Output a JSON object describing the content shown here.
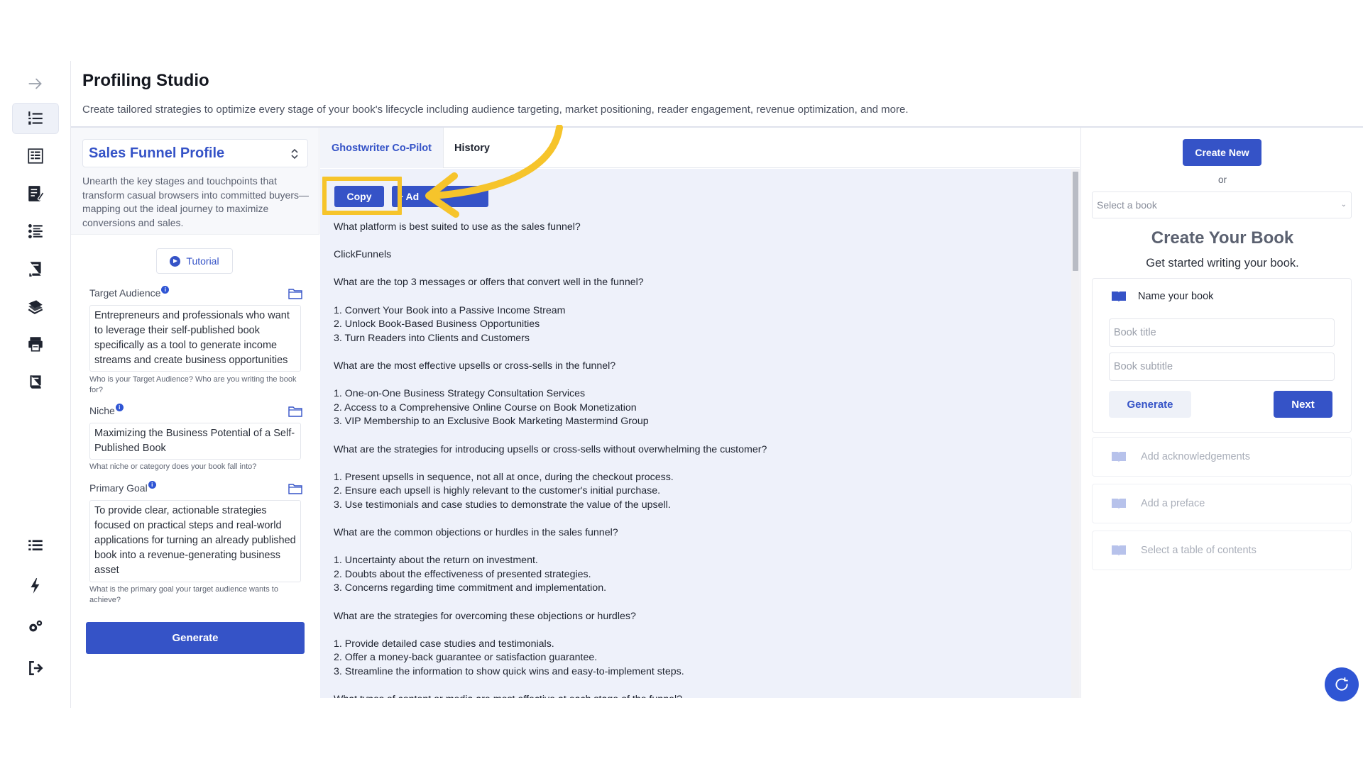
{
  "header": {
    "title": "Profiling Studio",
    "subtitle": "Create tailored strategies to optimize every stage of your book's lifecycle including audience targeting, market positioning, reader engagement, revenue optimization, and more."
  },
  "sidebar": {
    "items": [
      {
        "icon": "arrow-right-icon"
      },
      {
        "icon": "list-numbered-icon",
        "active": true
      },
      {
        "icon": "book-outline-icon"
      },
      {
        "icon": "edit-doc-icon"
      },
      {
        "icon": "list-ordered-icon"
      },
      {
        "icon": "book-stand-icon"
      },
      {
        "icon": "books-stack-icon"
      },
      {
        "icon": "printer-icon"
      },
      {
        "icon": "book-closed-icon"
      },
      {
        "icon": "menu-list-icon"
      },
      {
        "icon": "lightning-icon"
      },
      {
        "icon": "gears-icon"
      },
      {
        "icon": "logout-icon"
      }
    ]
  },
  "profile": {
    "selected": "Sales Funnel Profile",
    "description": "Unearth the key stages and touchpoints that transform casual browsers into committed buyers—mapping out the ideal journey to maximize conversions and sales.",
    "tutorial_label": "Tutorial",
    "fields": [
      {
        "label": "Target Audience",
        "value": "Entrepreneurs and professionals who want to leverage their self-published book specifically as a tool to generate income streams and create business opportunities",
        "help": "Who is your Target Audience? Who are you writing the book for?"
      },
      {
        "label": "Niche",
        "value": "Maximizing the Business Potential of a Self-Published Book",
        "help": "What niche or category does your book fall into?"
      },
      {
        "label": "Primary Goal",
        "value": "To provide clear, actionable strategies focused on practical steps and real-world applications for turning an already published book into a revenue-generating business asset",
        "help": "What is the primary goal your target audience wants to achieve?"
      }
    ],
    "generate_label": "Generate"
  },
  "center": {
    "tabs": [
      "Ghostwriter Co-Pilot",
      "History"
    ],
    "copy_label": "Copy",
    "add_label": "+ Ad",
    "lines": [
      "What platform is best suited to use as the sales funnel?",
      "",
      "ClickFunnels",
      "",
      "What are the top 3 messages or offers that convert well in the funnel?",
      "",
      "1. Convert Your Book into a Passive Income Stream",
      "2. Unlock Book-Based Business Opportunities",
      "3. Turn Readers into Clients and Customers",
      "",
      "What are the most effective upsells or cross-sells in the funnel?",
      "",
      "1. One-on-One Business Strategy Consultation Services",
      "2. Access to a Comprehensive Online Course on Book Monetization",
      "3. VIP Membership to an Exclusive Book Marketing Mastermind Group",
      "",
      "What are the strategies for introducing upsells or cross-sells without overwhelming the customer?",
      "",
      "1. Present upsells in sequence, not all at once, during the checkout process.",
      "2. Ensure each upsell is highly relevant to the customer's initial purchase.",
      "3. Use testimonials and case studies to demonstrate the value of the upsell.",
      "",
      "What are the common objections or hurdles in the sales funnel?",
      "",
      "1. Uncertainty about the return on investment.",
      "2. Doubts about the effectiveness of presented strategies.",
      "3. Concerns regarding time commitment and implementation.",
      "",
      "What are the strategies for overcoming these objections or hurdles?",
      "",
      "1. Provide detailed case studies and testimonials.",
      "2. Offer a money-back guarantee or satisfaction guarantee.",
      "3. Streamline the information to show quick wins and easy-to-implement steps.",
      "",
      "What types of content or media are most effective at each stage of the funnel?"
    ]
  },
  "right": {
    "create_new_label": "Create New",
    "or_label": "or",
    "select_placeholder": "Select a book",
    "create_title": "Create Your Book",
    "create_subtitle": "Get started writing your book.",
    "card_title": "Name your book",
    "title_placeholder": "Book title",
    "subtitle_placeholder": "Book subtitle",
    "generate_label": "Generate",
    "next_label": "Next",
    "steps": [
      "Add acknowledgements",
      "Add a preface",
      "Select a table of contents"
    ]
  },
  "colors": {
    "accent": "#3553c7",
    "highlight": "#f6c42b",
    "content_bg": "#eef1fa"
  }
}
